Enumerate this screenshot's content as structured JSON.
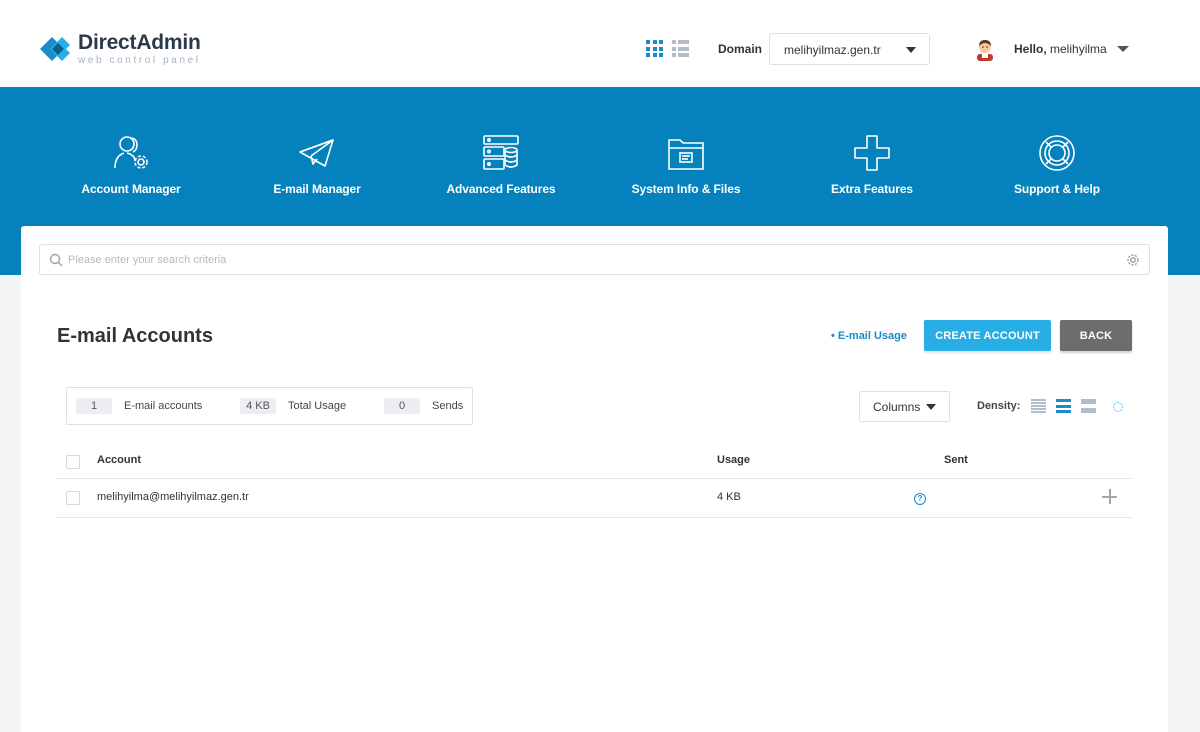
{
  "brand": {
    "title": "DirectAdmin",
    "subtitle": "web control panel",
    "colors": {
      "primary_blue": "#0582bd",
      "accent": "#28aee6",
      "dark": "#2b3a4a"
    }
  },
  "header": {
    "domain_label": "Domain",
    "domain_value": "melihyilmaz.gen.tr",
    "hello_prefix": "Hello,",
    "username": "melihyilma"
  },
  "nav": {
    "items": [
      {
        "label": "Account Manager",
        "icon": "users-gear-icon"
      },
      {
        "label": "E-mail Manager",
        "icon": "paper-plane-icon"
      },
      {
        "label": "Advanced Features",
        "icon": "server-database-icon"
      },
      {
        "label": "System Info & Files",
        "icon": "folder-icon"
      },
      {
        "label": "Extra Features",
        "icon": "plus-icon"
      },
      {
        "label": "Support & Help",
        "icon": "lifebuoy-icon"
      }
    ]
  },
  "search": {
    "placeholder": "Please enter your search criteria"
  },
  "page": {
    "title": "E-mail Accounts",
    "usage_link": "• E-mail Usage",
    "create_button": "CREATE ACCOUNT",
    "back_button": "BACK"
  },
  "stats": [
    {
      "value": "1",
      "label": "E-mail accounts"
    },
    {
      "value": "4 KB",
      "label": "Total Usage"
    },
    {
      "value": "0",
      "label": "Sends"
    }
  ],
  "toolbar": {
    "columns_label": "Columns",
    "density_label": "Density:"
  },
  "table": {
    "headers": {
      "account": "Account",
      "usage": "Usage",
      "sent": "Sent"
    },
    "rows": [
      {
        "account": "melihyilma@melihyilmaz.gen.tr",
        "usage": "4 KB",
        "sent": "?"
      }
    ]
  }
}
